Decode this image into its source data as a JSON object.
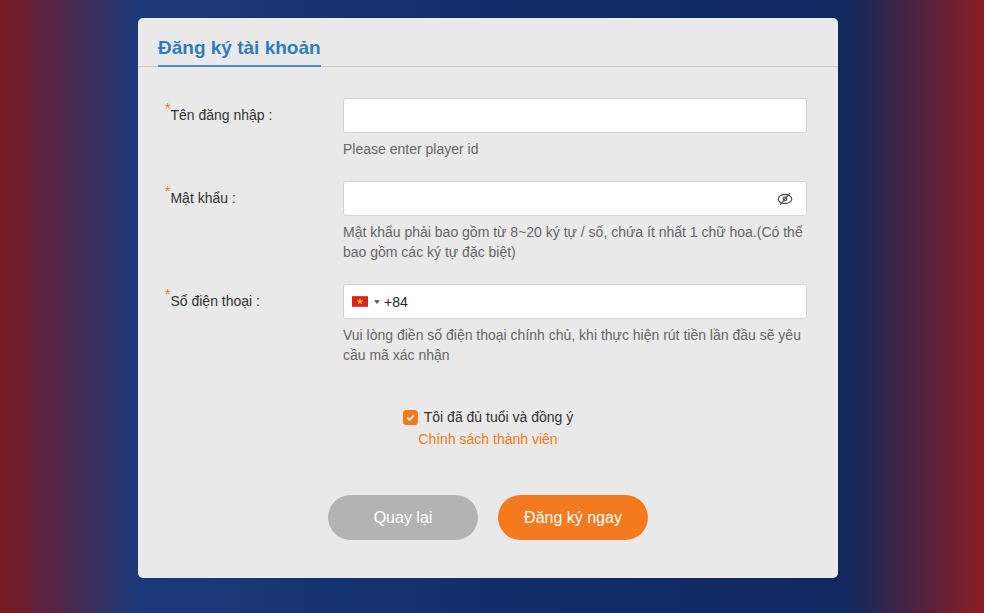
{
  "form": {
    "title": "Đăng ký tài khoản",
    "required_mark": "*",
    "fields": [
      {
        "kind": "text",
        "label": "Tên đăng nhập :",
        "required": true,
        "value": "",
        "hint": "Please enter player id"
      },
      {
        "kind": "password",
        "label": "Mật khẩu :",
        "required": true,
        "value": "",
        "password_visible": false,
        "hint": "Mật khẩu phải bao gồm từ 8~20 ký tự / số, chứa ít nhất 1 chữ hoa.(Có thể bao gồm các ký tự đặc biệt)"
      },
      {
        "kind": "phone",
        "label": "Số điện thoại :",
        "required": true,
        "value": "+84",
        "hint": "Vui lòng điền số điện thoại chính chủ, khi thực hiện rút tiền lần đầu sẽ yêu cầu mã xác nhận"
      }
    ],
    "agreement": {
      "checked": true,
      "text": "Tôi đã đủ tuổi và đồng ý",
      "link": "Chính sách thành viên"
    },
    "buttons": [
      {
        "label": "Quay lại",
        "kind": "secondary"
      },
      {
        "label": "Đăng ký ngay",
        "kind": "primary"
      }
    ]
  }
}
